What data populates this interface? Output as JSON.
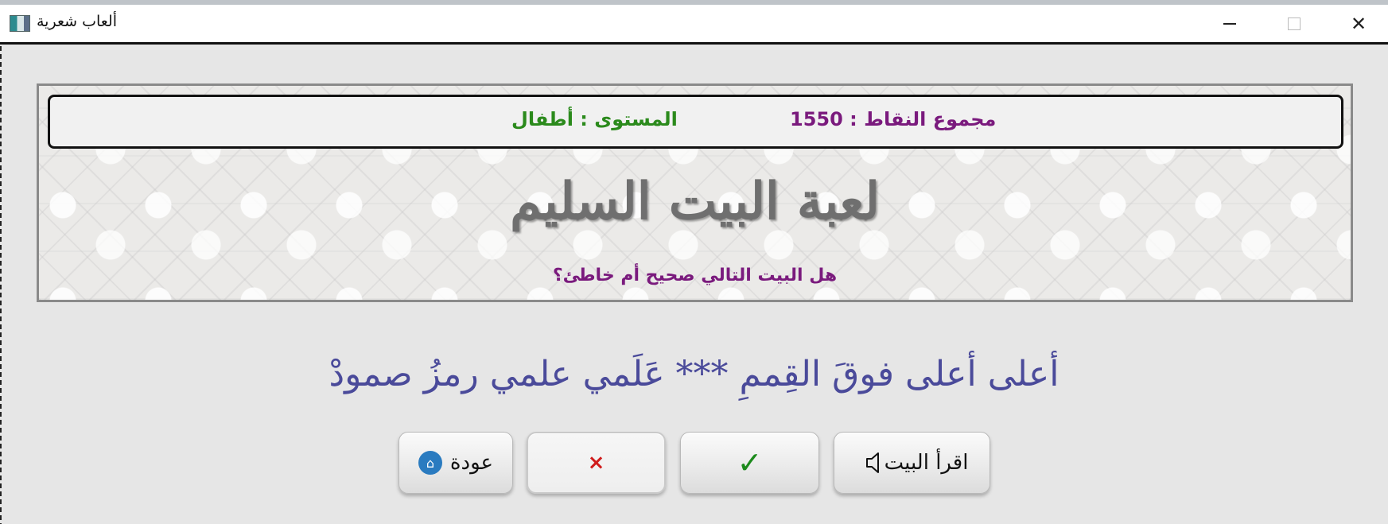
{
  "window": {
    "title": "ألعاب شعرية",
    "controls": {
      "minimize": "—",
      "maximize": "□",
      "close": "✕"
    }
  },
  "status": {
    "score": "مجموع النقاط : 1550",
    "level": "المستوى : أطفال"
  },
  "game": {
    "title": "لعبة البيت السليم",
    "question": "هل البيت التالي صحيح أم خاطئ؟"
  },
  "verse": "أعلى أعلى فوقَ القِممِ  ***  عَلَمي علمي رمزُ صمودْ",
  "buttons": {
    "read": "اقرأ البيت",
    "correct": "✓",
    "wrong": "×",
    "back": "عودة",
    "home_glyph": "⌂"
  },
  "colors": {
    "score": "#7a1a7d",
    "level": "#2b8a1c",
    "verse": "#4a4a9a",
    "title": "#6f6f6f",
    "check": "#1c8a1c",
    "cross": "#d01c1c"
  }
}
